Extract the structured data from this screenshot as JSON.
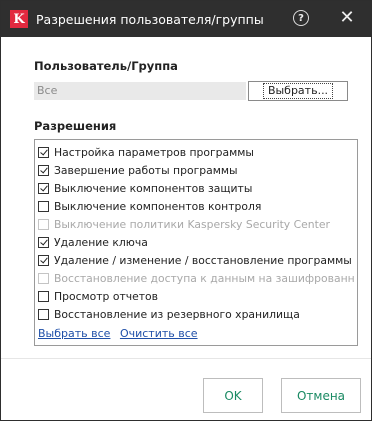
{
  "window": {
    "title": "Разрешения пользователя/группы",
    "logo_letter": "K",
    "help_symbol": "?",
    "close_symbol": "✕"
  },
  "user_group": {
    "label": "Пользователь/Группа",
    "value": "Все",
    "select_button": "Выбрать..."
  },
  "permissions": {
    "label": "Разрешения",
    "items": [
      {
        "label": "Настройка параметров программы",
        "checked": true,
        "enabled": true
      },
      {
        "label": "Завершение работы программы",
        "checked": true,
        "enabled": true
      },
      {
        "label": "Выключение компонентов защиты",
        "checked": true,
        "enabled": true
      },
      {
        "label": "Выключение компонентов контроля",
        "checked": false,
        "enabled": true
      },
      {
        "label": "Выключение политики Kaspersky Security Center",
        "checked": false,
        "enabled": false
      },
      {
        "label": "Удаление ключа",
        "checked": true,
        "enabled": true
      },
      {
        "label": "Удаление / изменение / восстановление программы",
        "checked": true,
        "enabled": true
      },
      {
        "label": "Восстановление доступа к данным на зашифрованн...",
        "checked": false,
        "enabled": false
      },
      {
        "label": "Просмотр отчетов",
        "checked": false,
        "enabled": true
      },
      {
        "label": "Восстановление из резервного хранилища",
        "checked": false,
        "enabled": true
      }
    ],
    "select_all": "Выбрать все",
    "clear_all": "Очистить все"
  },
  "footer": {
    "ok": "OK",
    "cancel": "Отмена"
  },
  "colors": {
    "titlebar": "#2f2f2f",
    "brand": "#e2293f",
    "button_text": "#1a8a63",
    "link": "#1f4fa8"
  }
}
